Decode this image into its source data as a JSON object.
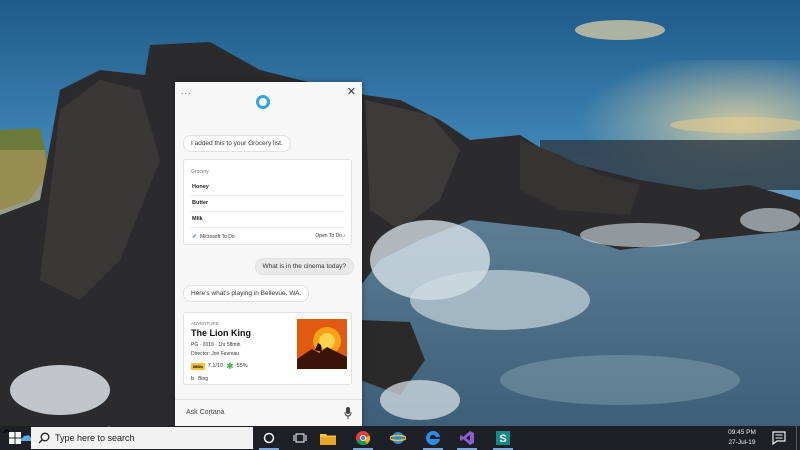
{
  "cortana": {
    "menu_dots": "...",
    "close": "✕",
    "msg_grocery": "I added this to your Grocery list.",
    "grocery": {
      "title": "Grocery",
      "items": [
        "Honey",
        "Butter",
        "Milk"
      ],
      "source": "Microsoft To Do",
      "open_link": "Open To Do ›"
    },
    "user_query": "What is in the cinema today?",
    "msg_cinema": "Here's what's playing in Bellevue, WA.",
    "movie": {
      "genre": "ADVENTURE",
      "title": "The Lion King",
      "meta": "PG · 2019 · 1hr 58min",
      "director": "Director: Jon Favreau",
      "imdb_badge": "IMDb",
      "imdb_score": "7.1/10",
      "rt_score": "55%",
      "provider": "Bing"
    },
    "ask_placeholder": "Ask Cortana"
  },
  "taskbar": {
    "search_placeholder": "Type here to search",
    "apps": [
      "cortana-ring",
      "task-view",
      "file-explorer",
      "chrome",
      "network-app",
      "edge",
      "visual-studio",
      "sway"
    ],
    "time": "09:45 PM",
    "date": "27-Jul-19"
  },
  "colors": {
    "cortana_accent": "#2fa7e6",
    "taskbar_bg": "#1d2026"
  }
}
